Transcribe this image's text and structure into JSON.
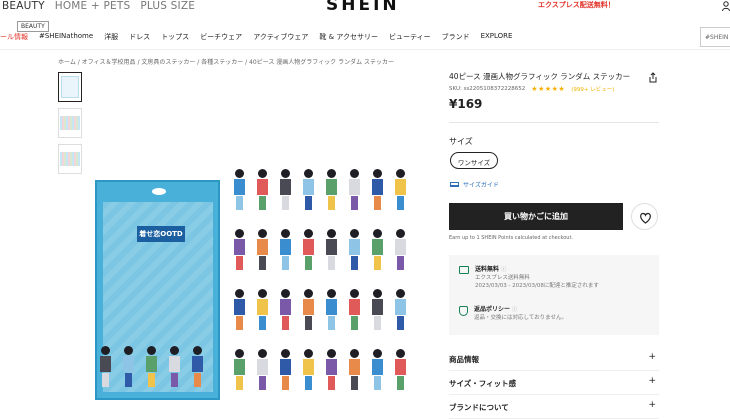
{
  "header": {
    "top_links": [
      "BEAUTY",
      "HOME + PETS",
      "PLUS SIZE"
    ],
    "logo": "SHEIN",
    "promo": "エクスプレス配送無料！",
    "tooltip": "BEAUTY"
  },
  "nav": {
    "items": [
      "ール情報",
      "#SHEINathome",
      "洋服",
      "ドレス",
      "トップス",
      "ビーチウェア",
      "アクティブウェア",
      "靴 & アクセサリー",
      "ビューティー",
      "ブランド",
      "EXPLORE"
    ],
    "search_placeholder": "#SHEIN"
  },
  "breadcrumb": "ホーム / オフィス＆学校用品 / 文房具のステッカー / 各種ステッカー / 40ピース 漫画人物グラフィック ランダム ステッカー",
  "product": {
    "title": "40ピース 漫画人物グラフィック ランダム ステッカー",
    "sku_label": "SKU: ss2205108372228652",
    "stars": "★★★★★",
    "reviews": "(999+ レビュー)",
    "price": "¥169",
    "pack_label": "着せ恋OOTD"
  },
  "options": {
    "size_title": "サイズ",
    "size_value": "ワンサイズ",
    "size_guide": "サイズガイド"
  },
  "actions": {
    "cart_label": "買い物かごに追加",
    "points_text": "Earn up to 1 SHEIN Points calculated at checkout."
  },
  "shipping": {
    "title": "送料無料",
    "line1": "エクスプレス送料無料",
    "line2": "2023/03/03 - 2023/03/08に配達と推定されます"
  },
  "returns": {
    "title": "返品ポリシー",
    "text": "返品・交換には対応しておりません。"
  },
  "accordion": [
    {
      "label": "商品情報"
    },
    {
      "label": "サイズ・フィット感"
    },
    {
      "label": "ブランドについて"
    }
  ],
  "colors": {
    "accent": "#222222",
    "sale_red": "#e0352b",
    "star": "#f6b100",
    "green": "#198055",
    "pack_blue": "#49b1d9"
  }
}
